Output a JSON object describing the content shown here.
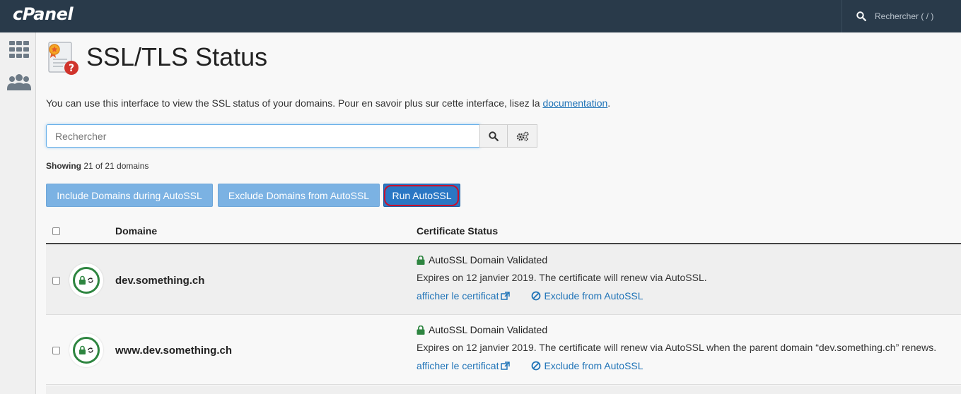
{
  "app": {
    "logo": "cPanel"
  },
  "top_search": {
    "placeholder": "Rechercher ( / )",
    "icon": "search-icon"
  },
  "sidebar": {
    "items": [
      {
        "icon": "grid-icon"
      },
      {
        "icon": "users-icon"
      }
    ]
  },
  "page": {
    "title": "SSL/TLS Status",
    "intro_text": "You can use this interface to view the SSL status of your domains. Pour en savoir plus sur cette interface, lisez la ",
    "intro_link": "documentation",
    "intro_end": "."
  },
  "search": {
    "placeholder": "Rechercher"
  },
  "showing": {
    "label": "Showing",
    "text": " 21 of 21 domains"
  },
  "actions": {
    "include": "Include Domains during AutoSSL",
    "exclude": "Exclude Domains from AutoSSL",
    "run": "Run AutoSSL"
  },
  "table": {
    "columns": {
      "domain": "Domaine",
      "status": "Certificate Status"
    },
    "rows": [
      {
        "domain": "dev.something.ch",
        "status": "AutoSSL Domain Validated",
        "expires": "Expires on 12 janvier 2019. The certificate will renew via AutoSSL.",
        "view_link": "afficher le certificat",
        "exclude_link": "Exclude from AutoSSL"
      },
      {
        "domain": "www.dev.something.ch",
        "status": "AutoSSL Domain Validated",
        "expires": "Expires on 12 janvier 2019. The certificate will renew via AutoSSL when the parent domain “dev.something.ch” renews.",
        "view_link": "afficher le certificat",
        "exclude_link": "Exclude from AutoSSL"
      }
    ]
  },
  "colors": {
    "topbar": "#293a4a",
    "accent": "#2a77c4",
    "valid": "#2e8540",
    "link": "#1f73b7",
    "highlight": "#c8102e"
  }
}
